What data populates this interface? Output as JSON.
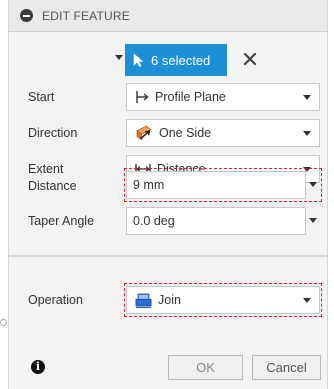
{
  "header": {
    "title": "EDIT FEATURE"
  },
  "selection": {
    "label": "6 selected"
  },
  "fields": {
    "start": {
      "label": "Start",
      "value": "Profile Plane"
    },
    "direction": {
      "label": "Direction",
      "value": "One Side"
    },
    "extent": {
      "label": "Extent",
      "value": "Distance"
    },
    "distance": {
      "label": "Distance",
      "value": "9 mm"
    },
    "taper": {
      "label": "Taper Angle",
      "value": "0.0 deg"
    },
    "operation": {
      "label": "Operation",
      "value": "Join"
    }
  },
  "footer": {
    "ok_label": "OK",
    "cancel_label": "Cancel"
  },
  "colors": {
    "accent": "#1c8fd6",
    "highlight": "#e0202a",
    "direction_icon": "#e07a2a",
    "join_icon": "#2a6fd6"
  },
  "icons": [
    "collapse-icon",
    "cursor-icon",
    "close-icon",
    "profile-plane-icon",
    "one-side-icon",
    "distance-icon",
    "join-icon",
    "info-icon",
    "chevron-down-icon"
  ]
}
